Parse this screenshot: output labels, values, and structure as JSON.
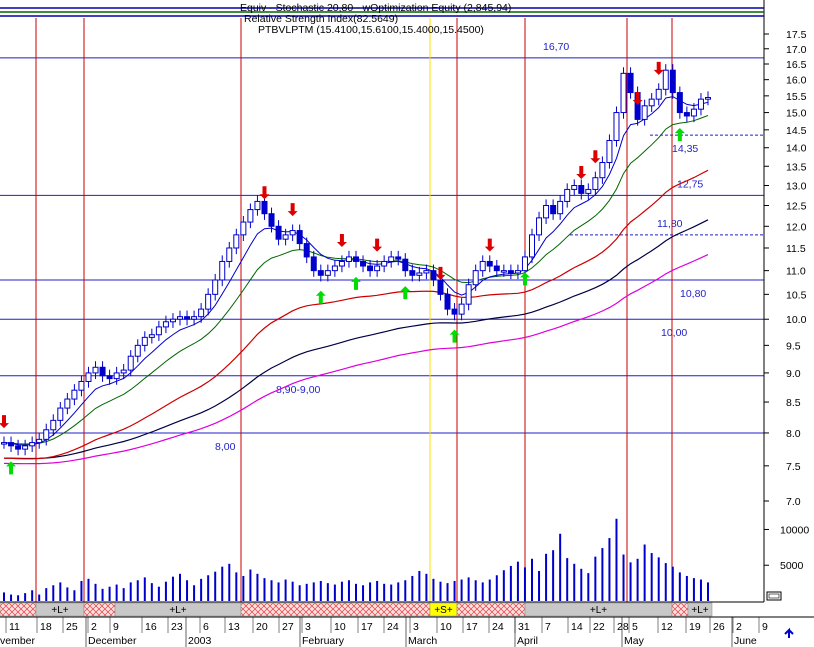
{
  "header": {
    "line1": "Equiv - Stochastic 20,80 - wOptimization Equity (2,845,94)",
    "line2": "Relative Strength Index(82.5649)",
    "line3": "PTBVLPTM (15.4100,15.6100,15.4000,15.4500)"
  },
  "colors": {
    "candle": "#0000cc",
    "up_arrow": "#00dd00",
    "down_arrow": "#dd0000",
    "ma_short": "#0000cc",
    "ma_mid": "#006600",
    "ma_long_red": "#cc0000",
    "ma_navy": "#000044",
    "ma_magenta": "#dd00dd",
    "level_line": "#1f1fc8",
    "vline_red": "#cc0000",
    "vline_yellow": "#ffdd00",
    "volume": "#0000cc"
  },
  "chart_data": {
    "type": "candlestick",
    "y_axis": {
      "ticks": [
        "7.0",
        "7.5",
        "8.0",
        "8.5",
        "9.0",
        "9.5",
        "10.0",
        "10.5",
        "11.0",
        "11.5",
        "12.0",
        "12.5",
        "13.0",
        "13.5",
        "14.0",
        "14.5",
        "15.0",
        "15.5",
        "16.0",
        "16.5",
        "17.0",
        "17.5"
      ],
      "scale": "log"
    },
    "volume_axis": {
      "ticks": [
        "10000",
        "5000"
      ]
    },
    "levels": [
      {
        "label": "16,70",
        "value": 16.7,
        "style": "solid"
      },
      {
        "label": "14,35",
        "value": 14.35,
        "style": "dashed"
      },
      {
        "label": "12,75",
        "value": 12.75,
        "style": "solid"
      },
      {
        "label": "11,80",
        "value": 11.8,
        "style": "dashed"
      },
      {
        "label": "10,80",
        "value": 10.8,
        "style": "solid"
      },
      {
        "label": "10,00",
        "value": 10.0,
        "style": "solid"
      },
      {
        "label": "8,90-9,00",
        "value": 8.95,
        "style": "solid"
      },
      {
        "label": "8,00",
        "value": 8.0,
        "style": "solid"
      }
    ],
    "x_axis": {
      "day_ticks": [
        "11",
        "18",
        "25",
        "2",
        "9",
        "16",
        "23",
        "6",
        "13",
        "20",
        "27",
        "3",
        "10",
        "17",
        "24",
        "3",
        "10",
        "17",
        "24",
        "31",
        "7",
        "14",
        "22",
        "28",
        "5",
        "12",
        "19",
        "26",
        "2",
        "9"
      ],
      "month_labels": [
        "vember",
        "December",
        "2003",
        "February",
        "March",
        "April",
        "May",
        "June"
      ]
    },
    "signal_bands": [
      "+L+",
      "+L+",
      "+S+",
      "+L+",
      "+L+"
    ],
    "prices": [
      7.85,
      7.8,
      7.75,
      7.8,
      7.85,
      7.9,
      8.05,
      8.2,
      8.4,
      8.55,
      8.7,
      8.85,
      9.0,
      9.1,
      8.95,
      8.9,
      9.0,
      9.05,
      9.3,
      9.5,
      9.65,
      9.7,
      9.85,
      9.95,
      10.0,
      10.05,
      10.0,
      10.05,
      10.2,
      10.5,
      10.8,
      11.2,
      11.5,
      11.8,
      12.1,
      12.4,
      12.6,
      12.3,
      12.0,
      11.7,
      11.8,
      11.9,
      11.6,
      11.3,
      11.0,
      10.9,
      11.0,
      11.1,
      11.2,
      11.3,
      11.2,
      11.1,
      11.0,
      11.1,
      11.2,
      11.3,
      11.25,
      11.0,
      10.9,
      10.95,
      11.0,
      10.8,
      10.5,
      10.2,
      10.1,
      10.3,
      10.7,
      11.0,
      11.2,
      11.1,
      11.0,
      11.0,
      10.95,
      11.0,
      11.3,
      11.8,
      12.2,
      12.5,
      12.3,
      12.6,
      12.9,
      13.0,
      12.8,
      12.9,
      13.2,
      13.6,
      14.2,
      15.0,
      16.2,
      15.6,
      14.8,
      15.2,
      15.4,
      15.7,
      16.3,
      15.6,
      15.0,
      14.9,
      15.1,
      15.4,
      15.45
    ],
    "volume": [
      1200,
      900,
      800,
      1100,
      1500,
      900,
      1800,
      2200,
      2600,
      1900,
      1500,
      2800,
      3100,
      2400,
      1700,
      2000,
      2300,
      1800,
      2600,
      2900,
      3300,
      2500,
      2000,
      2700,
      3400,
      3800,
      2900,
      2200,
      3100,
      3600,
      4100,
      4800,
      5200,
      4000,
      3500,
      4400,
      3800,
      3200,
      2900,
      2600,
      3000,
      2700,
      2200,
      2400,
      2600,
      2800,
      2500,
      2300,
      2700,
      2900,
      2400,
      2200,
      2600,
      2800,
      2400,
      2300,
      2600,
      2900,
      3500,
      4200,
      3800,
      3100,
      2700,
      2500,
      2800,
      3000,
      3300,
      2900,
      2600,
      3000,
      3600,
      4300,
      4900,
      5500,
      4700,
      5900,
      4200,
      6600,
      7100,
      9400,
      6000,
      5200,
      4500,
      3900,
      6200,
      7400,
      8800,
      11500,
      6500,
      5400,
      5900,
      7900,
      6700,
      6100,
      5300,
      4800,
      4000,
      3500,
      3200,
      3000,
      2600
    ]
  }
}
